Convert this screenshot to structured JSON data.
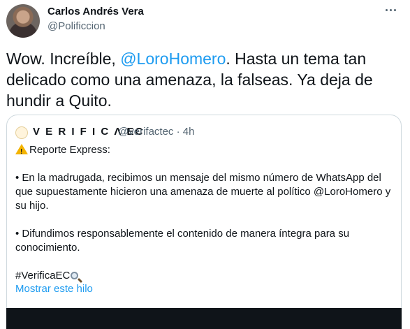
{
  "tweet": {
    "author_name": "Carlos Andrés Vera",
    "author_handle": "@Polificcion",
    "text_1": "Wow. Increíble, ",
    "mention": "@LoroHomero",
    "text_2": ". Hasta un tema tan delicado como una amenaza, la falseas. Ya deja de hundir a Quito.",
    "more_icon": "more-horizontal-icon"
  },
  "quote": {
    "author_name": "V E R I F I C Λ EC",
    "author_handle": "@verifactec · 4h",
    "line_1": "Reporte Express:",
    "line_2": "• En la madrugada, recibimos un mensaje del mismo número de WhatsApp del que supuestamente hicieron una amenaza de muerte al político @LoroHomero y su hijo.",
    "line_3": "• Difundimos responsablemente el contenido de manera íntegra para su conocimiento.",
    "hashtag": "#VerificaEC",
    "show_thread": "Mostrar este hilo"
  },
  "colors": {
    "link": "#1d9bf0",
    "muted": "#536471",
    "text": "#0f1419",
    "border": "#cfd9de"
  }
}
